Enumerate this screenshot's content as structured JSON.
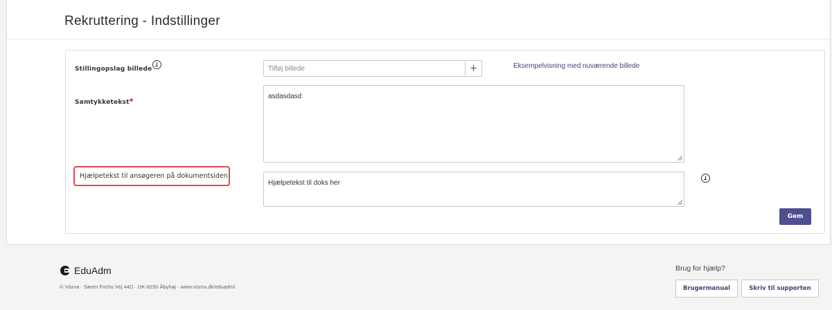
{
  "page": {
    "title": "Rekruttering - Indstillinger"
  },
  "form": {
    "image_field": {
      "label": "Stillingopslag billede",
      "placeholder": "Tilføj billede",
      "value": "",
      "add_symbol": "+",
      "preview_link": "Eksempelvisning med nuværende billede"
    },
    "consent_field": {
      "label": "Samtykketekst",
      "required_marker": "*",
      "value": "asdasdasd"
    },
    "help_field": {
      "label": "Hjælpetekst til ansøgeren på dokumentsiden",
      "value": "Hjælpetekst til doks her"
    },
    "save_label": "Gem"
  },
  "footer": {
    "logo_text": "EduAdm",
    "address": "© Visma · Søren Frichs Vej 44D · DK-8230 Åbyhøj · www.visma.dk/eduadm/",
    "help_title": "Brug for hjælp?",
    "manual_button": "Brugermanual",
    "support_button": "Skriv til supporten"
  },
  "colors": {
    "accent": "#4d4f8e",
    "link": "#40447a",
    "required": "#d0021b",
    "highlight_border": "#e04848"
  }
}
